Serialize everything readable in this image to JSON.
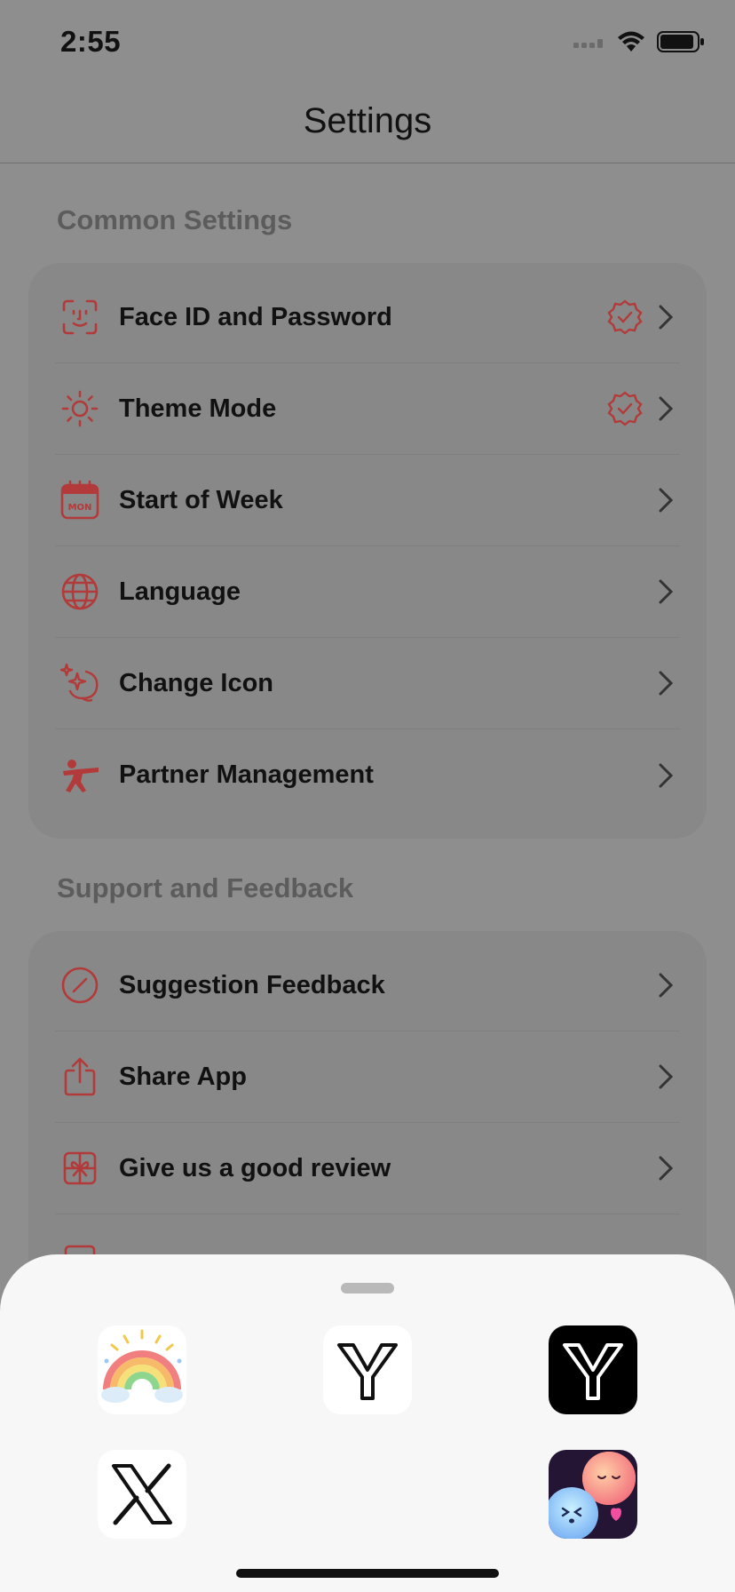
{
  "status": {
    "time": "2:55"
  },
  "nav": {
    "title": "Settings"
  },
  "sections": {
    "common": {
      "title": "Common Settings",
      "items": [
        {
          "label": "Face ID and Password",
          "icon": "face-id-icon",
          "badge": true
        },
        {
          "label": "Theme Mode",
          "icon": "sun-icon",
          "badge": true
        },
        {
          "label": "Start of Week",
          "icon": "calendar-mon-icon",
          "badge": false
        },
        {
          "label": "Language",
          "icon": "globe-icon",
          "badge": false
        },
        {
          "label": "Change Icon",
          "icon": "sparkle-icon",
          "badge": false
        },
        {
          "label": "Partner Management",
          "icon": "kick-icon",
          "badge": false
        }
      ]
    },
    "support": {
      "title": "Support and Feedback",
      "items": [
        {
          "label": "Suggestion Feedback",
          "icon": "pencil-circle-icon"
        },
        {
          "label": "Share App",
          "icon": "share-icon"
        },
        {
          "label": "Give us a good review",
          "icon": "gift-icon"
        }
      ]
    }
  },
  "sheet": {
    "icons": [
      "rainbow-app-icon",
      "y-light-app-icon",
      "y-dark-app-icon",
      "x-app-icon",
      "cute-faces-app-icon"
    ]
  },
  "colors": {
    "accent": "#b23a3a",
    "overlay": "#8e8e8e",
    "sheet": "#f7f7f7"
  }
}
